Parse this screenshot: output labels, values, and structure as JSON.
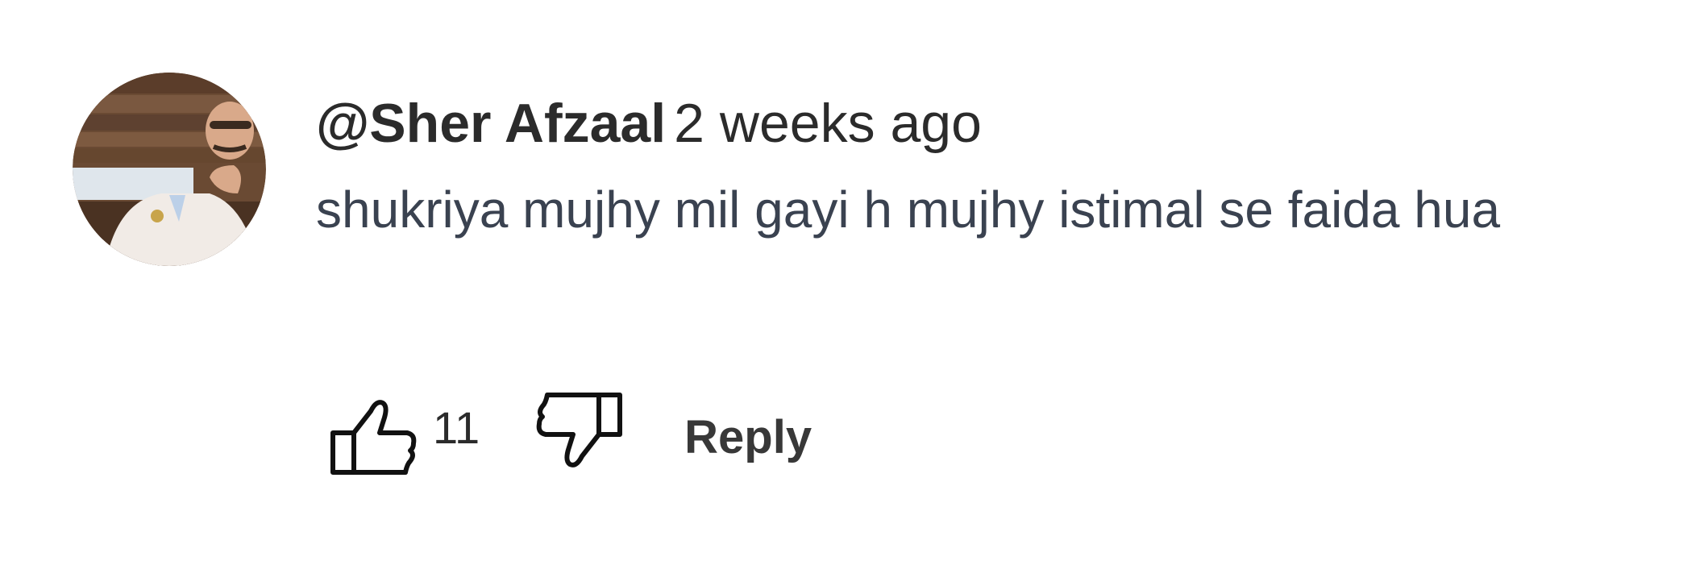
{
  "comment": {
    "author": "@Sher Afzaal",
    "timestamp": "2 weeks ago",
    "text": "shukriya mujhy mil gayi h mujhy istimal se faida hua",
    "like_count": "11",
    "reply_label": "Reply",
    "icons": {
      "like": "thumbs-up-icon",
      "dislike": "thumbs-down-icon"
    },
    "colors": {
      "author": "#2b2b2b",
      "text": "#3a4250",
      "icon_stroke": "#111111"
    }
  }
}
